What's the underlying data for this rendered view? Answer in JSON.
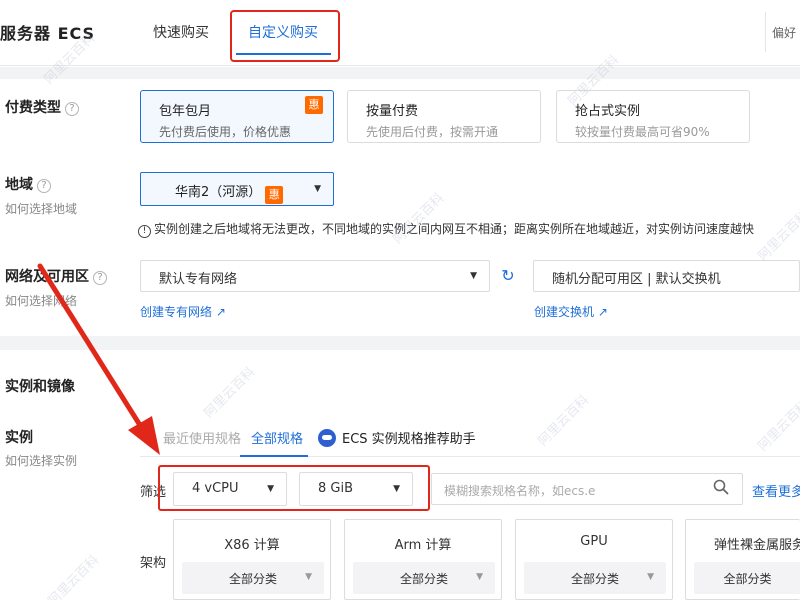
{
  "header": {
    "product_title": "服务器 ECS",
    "tabs": [
      {
        "label": "快速购买"
      },
      {
        "label": "自定义购买"
      }
    ],
    "prefs_label": "偏好"
  },
  "billing": {
    "label": "付费类型",
    "help": "?",
    "options": [
      {
        "title": "包年包月",
        "desc": "先付费后使用，价格优惠",
        "badge": "惠",
        "selected": true
      },
      {
        "title": "按量付费",
        "desc": "先使用后付费，按需开通",
        "selected": false
      },
      {
        "title": "抢占式实例",
        "desc": "较按量付费最高可省90%",
        "selected": false
      }
    ]
  },
  "region": {
    "label": "地域",
    "help": "?",
    "sub_label": "如何选择地域",
    "selected": "华南2（河源）",
    "badge": "惠",
    "notice_icon": "!",
    "notice": "实例创建之后地域将无法更改，不同地域的实例之间内网互不相通；距离实例所在地域越近，对实例访问速度越快"
  },
  "network": {
    "label": "网络及可用区",
    "help": "?",
    "sub_label": "如何选择网络",
    "vpc_value": "默认专有网络",
    "zone_value": "随机分配可用区 | 默认交换机",
    "create_vpc_link": "创建专有网络",
    "create_vswitch_link": "创建交换机",
    "external_icon": "external-link-icon",
    "refresh_icon": "refresh-icon"
  },
  "instance_section": {
    "title": "实例和镜像",
    "label": "实例",
    "sub_label": "如何选择实例",
    "tabs": [
      {
        "label": "最近使用规格"
      },
      {
        "label": "全部规格"
      },
      {
        "label": "ECS 实例规格推荐助手"
      }
    ],
    "filter_label": "筛选",
    "cpu_value": "4 vCPU",
    "mem_value": "8 GiB",
    "search_placeholder": "模糊搜索规格名称，如ecs.e",
    "view_more": "查看更多",
    "arch_label": "架构",
    "arch_options": [
      {
        "name": "X86 计算",
        "sub": "全部分类"
      },
      {
        "name": "Arm 计算",
        "sub": "全部分类"
      },
      {
        "name": "GPU",
        "sub": "全部分类"
      },
      {
        "name": "弹性裸金属服务",
        "sub": "全部分类"
      }
    ]
  },
  "watermark_text": "阿里云百科",
  "colors": {
    "accent": "#1e6fd9",
    "badge": "#ff6a00",
    "annotation_red": "#e0271a"
  }
}
